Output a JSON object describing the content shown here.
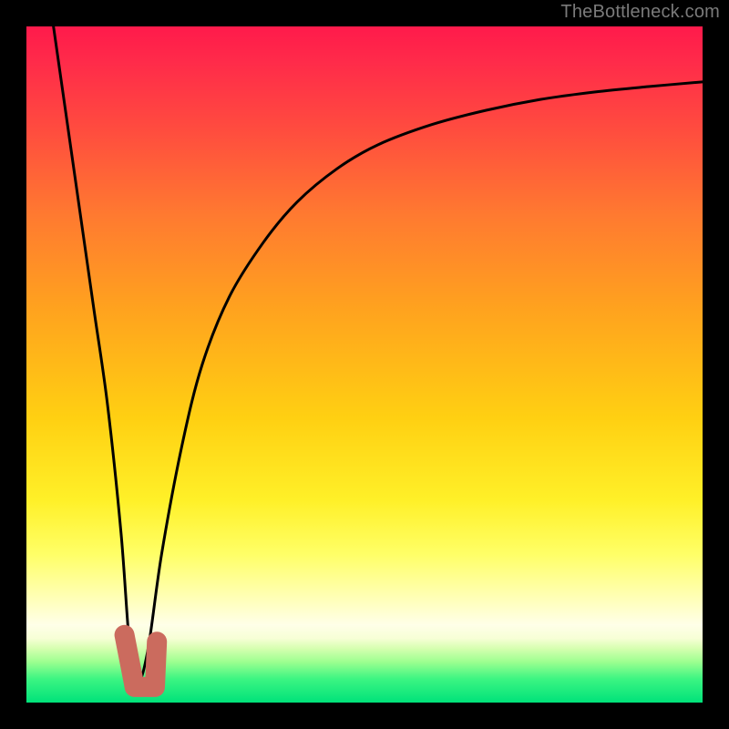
{
  "watermark": "TheBottleneck.com",
  "colors": {
    "frame": "#000000",
    "watermark": "#7a7a7a",
    "curve": "#000000",
    "marker_fill": "#cb6b5e",
    "marker_stroke": "#cb6b5e",
    "gradient_stops": [
      {
        "offset": 0.0,
        "color": "#ff1a4b"
      },
      {
        "offset": 0.05,
        "color": "#ff2a4a"
      },
      {
        "offset": 0.15,
        "color": "#ff4b3f"
      },
      {
        "offset": 0.28,
        "color": "#ff7a30"
      },
      {
        "offset": 0.42,
        "color": "#ffa31e"
      },
      {
        "offset": 0.58,
        "color": "#ffd012"
      },
      {
        "offset": 0.7,
        "color": "#fff028"
      },
      {
        "offset": 0.78,
        "color": "#ffff66"
      },
      {
        "offset": 0.84,
        "color": "#ffffb0"
      },
      {
        "offset": 0.885,
        "color": "#ffffe8"
      },
      {
        "offset": 0.905,
        "color": "#f7ffd6"
      },
      {
        "offset": 0.92,
        "color": "#d6ffb0"
      },
      {
        "offset": 0.94,
        "color": "#9cff90"
      },
      {
        "offset": 0.965,
        "color": "#3cf582"
      },
      {
        "offset": 1.0,
        "color": "#00e27a"
      }
    ]
  },
  "chart_data": {
    "type": "line",
    "title": "",
    "xlabel": "",
    "ylabel": "",
    "xlim": [
      0,
      100
    ],
    "ylim": [
      0,
      100
    ],
    "legend": false,
    "grid": false,
    "series": [
      {
        "name": "bottleneck-curve",
        "x": [
          4,
          6,
          8,
          10,
          12,
          14,
          15.3,
          16.5,
          18,
          20,
          23,
          26,
          30,
          35,
          40,
          46,
          52,
          60,
          68,
          76,
          84,
          92,
          100
        ],
        "y": [
          100,
          86,
          72,
          58,
          44,
          25,
          8,
          3,
          8,
          22,
          38,
          50,
          60,
          68,
          74,
          79,
          82.5,
          85.5,
          87.6,
          89.2,
          90.3,
          91.1,
          91.8
        ]
      }
    ],
    "marker": {
      "name": "selected-region",
      "points_xy": [
        [
          14.5,
          10
        ],
        [
          16.0,
          2.3
        ],
        [
          19.0,
          2.3
        ],
        [
          19.3,
          9.0
        ]
      ]
    }
  }
}
